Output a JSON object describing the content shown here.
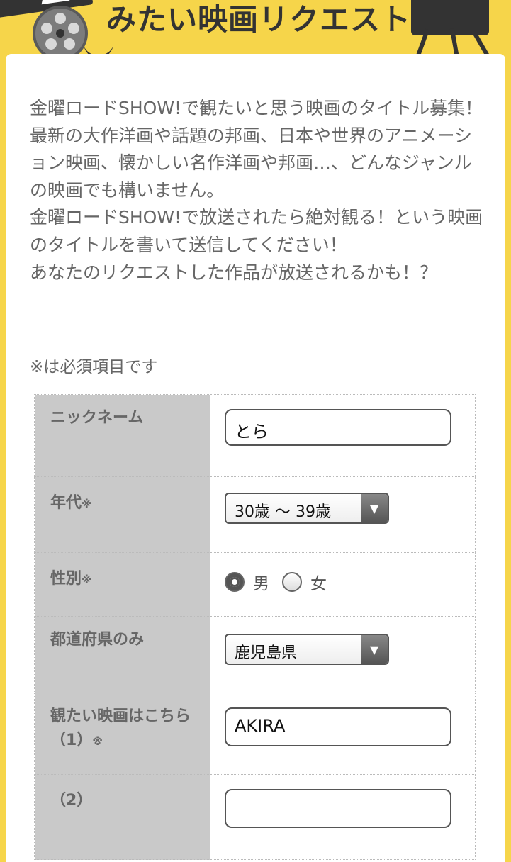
{
  "banner": {
    "title": "みたい映画リクエスト"
  },
  "intro": {
    "paragraphs": [
      "金曜ロードSHOW!で観たいと思う映画のタイトル募集！",
      "最新の大作洋画や話題の邦画、日本や世界のアニメーション映画、懐かしい名作洋画や邦画…、どんなジャンルの映画でも構いません。",
      "金曜ロードSHOW!で放送されたら絶対観る！という映画のタイトルを書いて送信してください！",
      "あなたのリクエストした作品が放送されるかも！？"
    ],
    "required_note": "※は必須項目です"
  },
  "form": {
    "required_mark": "※",
    "nickname": {
      "label": "ニックネーム",
      "value": "とら"
    },
    "age": {
      "label": "年代",
      "value": "30歳 〜 39歳"
    },
    "gender": {
      "label": "性別",
      "options": [
        "男",
        "女"
      ],
      "selected": "男"
    },
    "prefecture": {
      "label": "都道府県のみ",
      "value": "鹿児島県"
    },
    "movie1": {
      "label": "観たい映画はこちら（1）",
      "value": "AKIRA"
    },
    "movie2": {
      "label": "（2）",
      "value": ""
    }
  },
  "icons": {
    "dropdown": "▼"
  }
}
